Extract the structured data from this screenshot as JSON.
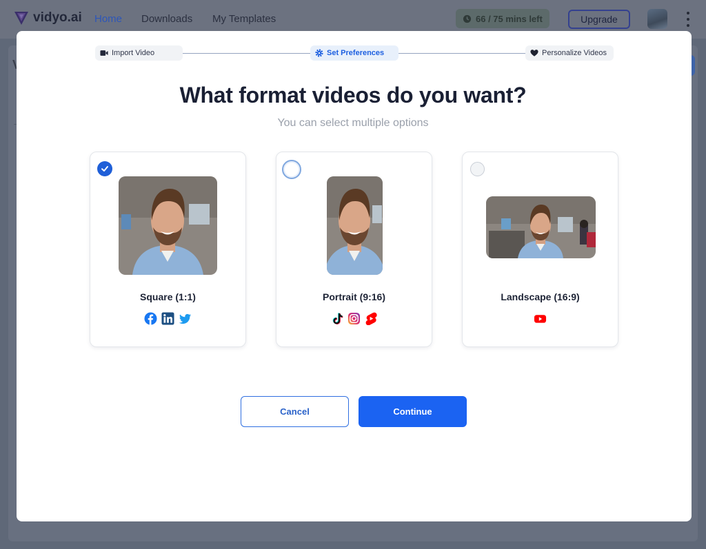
{
  "app": {
    "name": "vidyo.ai",
    "nav": [
      {
        "label": "Home"
      },
      {
        "label": "Downloads"
      },
      {
        "label": "My Templates"
      }
    ],
    "minutes_left": "66 / 75 mins left",
    "upgrade_label": "Upgrade",
    "bg_letter": "V"
  },
  "stepper": {
    "steps": [
      {
        "label": "Import Video",
        "icon": "video-camera-icon",
        "state": "done"
      },
      {
        "label": "Set Preferences",
        "icon": "gear-icon",
        "state": "active"
      },
      {
        "label": "Personalize Videos",
        "icon": "heart-icon",
        "state": "pending"
      }
    ]
  },
  "modal": {
    "title": "What format videos do you want?",
    "subtitle": "You can select multiple options",
    "formats": [
      {
        "label": "Square (1:1)",
        "selected": true,
        "platforms": [
          "facebook-icon",
          "linkedin-icon",
          "twitter-icon"
        ]
      },
      {
        "label": "Portrait (9:16)",
        "selected": false,
        "platforms": [
          "tiktok-icon",
          "instagram-icon",
          "youtube-shorts-icon"
        ]
      },
      {
        "label": "Landscape (16:9)",
        "selected": false,
        "platforms": [
          "youtube-icon"
        ]
      }
    ],
    "cancel_label": "Cancel",
    "continue_label": "Continue"
  },
  "colors": {
    "primary": "#1b63f2",
    "accent_check": "#1f5fd8",
    "overlay": "#5f6878"
  }
}
